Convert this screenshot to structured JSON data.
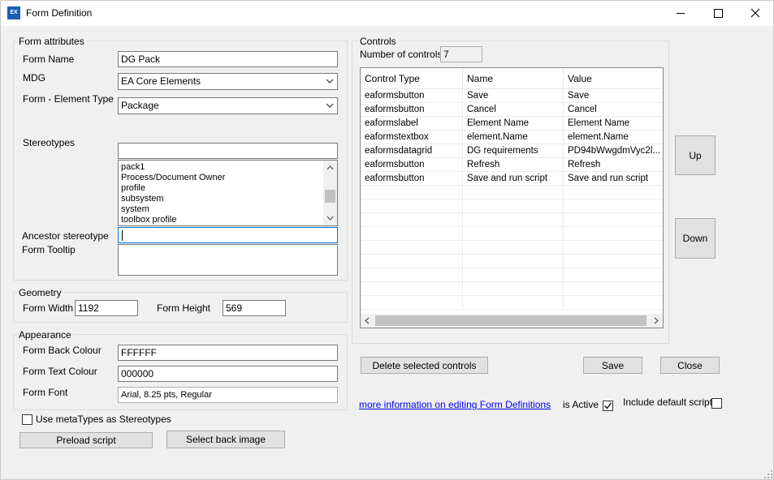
{
  "window": {
    "title": "Form Definition",
    "icon_text": "EX",
    "buttons": [
      "minimize-icon",
      "maximize-icon",
      "close-icon"
    ]
  },
  "form_attributes": {
    "group_title": "Form attributes",
    "form_name_label": "Form Name",
    "form_name_value": "DG Pack",
    "mdg_label": "MDG",
    "mdg_value": "EA Core Elements",
    "element_type_label": "Form - Element Type",
    "element_type_value": "Package",
    "stereotypes_label": "Stereotypes",
    "stereotypes_value": "",
    "stereotype_list": [
      "pack1",
      "Process/Document Owner",
      "profile",
      "subsystem",
      "system",
      "toolbox profile"
    ],
    "ancestor_label": "Ancestor stereotype",
    "ancestor_value": "",
    "tooltip_label": "Form Tooltip",
    "tooltip_value": ""
  },
  "geometry": {
    "group_title": "Geometry",
    "width_label": "Form Width",
    "width_value": "1192",
    "height_label": "Form Height",
    "height_value": "569"
  },
  "appearance": {
    "group_title": "Appearance",
    "back_colour_label": "Form Back Colour",
    "back_colour_value": "FFFFFF",
    "text_colour_label": "Form Text Colour",
    "text_colour_value": "000000",
    "font_label": "Form Font",
    "font_value": "Arial, 8.25 pts, Regular"
  },
  "bottom_left": {
    "metatypes_label": "Use metaTypes as Stereotypes",
    "metatypes_checked": false,
    "preload_label": "Preload script",
    "backimage_label": "Select back image"
  },
  "controls": {
    "group_title": "Controls",
    "count_label": "Number of controls",
    "count_value": "7",
    "columns": [
      "Control Type",
      "Name",
      "Value"
    ],
    "rows": [
      [
        "eaformsbutton",
        "Save",
        "Save"
      ],
      [
        "eaformsbutton",
        "Cancel",
        "Cancel"
      ],
      [
        "eaformslabel",
        "Element Name",
        "Element Name"
      ],
      [
        "eaformstextbox",
        "element.Name",
        "element.Name"
      ],
      [
        "eaformsdatagrid",
        "DG requirements",
        "PD94bWwgdmVyc2l..."
      ],
      [
        "eaformsbutton",
        "Refresh",
        "Refresh"
      ],
      [
        "eaformsbutton",
        "Save and run script",
        "Save and run script"
      ]
    ],
    "up_label": "Up",
    "down_label": "Down"
  },
  "actions": {
    "delete_label": "Delete selected controls",
    "save_label": "Save",
    "close_label": "Close",
    "more_info_link": "more information on editing Form Definitions",
    "is_active_label": "is Active",
    "is_active_checked": true,
    "include_default_label": "Include default script",
    "include_default_checked": false
  },
  "colors": {
    "window_bg": "#f0f0f0",
    "link": "#0000ee",
    "focus_border": "#0078d7",
    "button_bg": "#e1e1e1"
  }
}
